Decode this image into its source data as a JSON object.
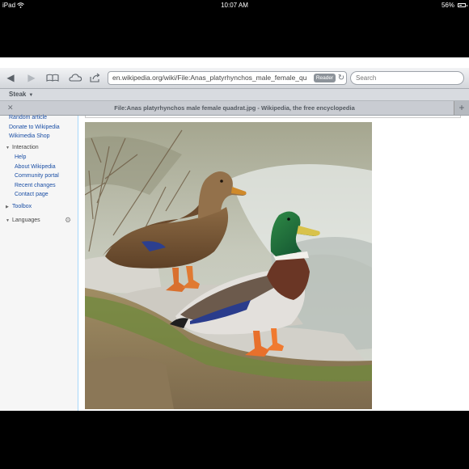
{
  "status_bar": {
    "device": "iPad",
    "time": "10:07 AM",
    "battery_text": "56%",
    "battery_level": 0.56
  },
  "toolbar": {
    "back_icon": "back-arrow-icon",
    "forward_icon": "forward-arrow-icon",
    "bookmarks_icon": "open-book-icon",
    "icloud_icon": "cloud-icon",
    "share_icon": "share-icon",
    "url": "en.wikipedia.org/wiki/File:Anas_platyrhynchos_male_female_quadrat.jpg",
    "reader_label": "Reader",
    "search_placeholder": "Search"
  },
  "bookmarks_bar": {
    "items": [
      {
        "label": "Steak"
      }
    ]
  },
  "tab": {
    "title": "File:Anas platyrhynchos male female quadrat.jpg - Wikipedia, the free encyclopedia"
  },
  "sidebar": {
    "top_links": [
      "Random article",
      "Donate to Wikipedia",
      "Wikimedia Shop"
    ],
    "interaction": {
      "heading": "Interaction",
      "links": [
        "Help",
        "About Wikipedia",
        "Community portal",
        "Recent changes",
        "Contact page"
      ]
    },
    "toolbox": {
      "heading": "Toolbox"
    },
    "languages": {
      "heading": "Languages"
    }
  },
  "colors": {
    "link": "#1b4fa5",
    "sidebar_bg": "#f6f6f6",
    "toolbar_gradient_top": "#f2f3f5",
    "toolbar_gradient_bottom": "#d3d6db"
  }
}
